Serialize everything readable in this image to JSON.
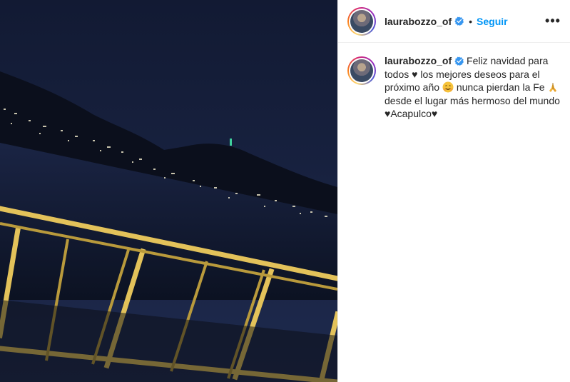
{
  "post": {
    "media_alt": "Night view of Acapulco bay from a balcony",
    "header": {
      "username": "laurabozzo_of",
      "separator": "•",
      "follow_label": "Seguir",
      "more_label": "•••"
    },
    "caption": {
      "username": "laurabozzo_of",
      "text_1": "Feliz navidad para todos ♥ los mejores deseos para el próximo año ",
      "text_2": " nunca pierdan la Fe ",
      "text_3": " desde el lugar más hermoso del mundo ♥Acapulco♥"
    }
  },
  "colors": {
    "accent": "#0095f6",
    "verified": "#3897f0",
    "railing": "#e3c25a",
    "text": "#262626"
  },
  "icons": [
    "verified-badge-icon",
    "more-options-icon",
    "smiling-face-emoji-icon",
    "folded-hands-emoji-icon"
  ]
}
